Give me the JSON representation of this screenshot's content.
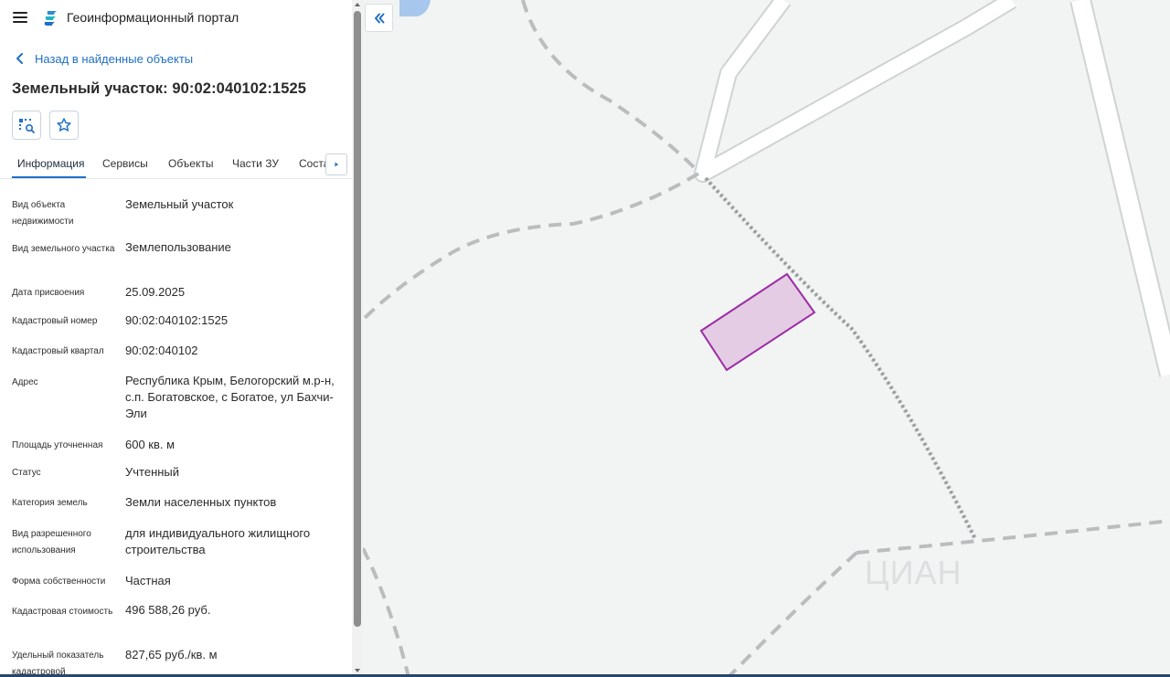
{
  "header": {
    "menu_icon": "hamburger-menu-icon",
    "logo_icon": "portal-logo-icon",
    "title": "Геоинформационный портал"
  },
  "back_link": {
    "icon": "chevron-left-icon",
    "label": "Назад в найденные объекты"
  },
  "object": {
    "title": "Земельный участок: 90:02:040102:1525"
  },
  "actions": [
    {
      "icon": "zoom-to-object-icon"
    },
    {
      "icon": "star-outline-icon"
    }
  ],
  "tabs": [
    {
      "label": "Информация",
      "active": true
    },
    {
      "label": "Сервисы",
      "active": false
    },
    {
      "label": "Объекты",
      "active": false
    },
    {
      "label": "Части ЗУ",
      "active": false
    },
    {
      "label": "Соста",
      "active": false
    }
  ],
  "tab_scroll_icon": "caret-right-icon",
  "attributes": [
    {
      "label": "Вид объекта недвижимости",
      "value": "Земельный участок"
    },
    {
      "label": "Вид земельного участка",
      "value": "Землепользование"
    },
    {
      "label": "Дата присвоения",
      "value": "25.09.2025"
    },
    {
      "label": "Кадастровый номер",
      "value": "90:02:040102:1525"
    },
    {
      "label": "Кадастровый квартал",
      "value": "90:02:040102"
    },
    {
      "label": "Адрес",
      "value": "Республика Крым, Белогорский м.р-н, с.п. Богатовское, с Богатое, ул Бахчи-Эли"
    },
    {
      "label": "Площадь уточненная",
      "value": "600 кв. м"
    },
    {
      "label": "Статус",
      "value": "Учтенный"
    },
    {
      "label": "Категория земель",
      "value": "Земли населенных пунктов"
    },
    {
      "label": "Вид разрешенного использования",
      "value": "для индивидуального жилищного строительства"
    },
    {
      "label": "Форма собственности",
      "value": "Частная"
    },
    {
      "label": "Кадастровая стоимость",
      "value": "496 588,26 руб."
    },
    {
      "label": "Удельный показатель кадастровой",
      "value": "827,65 руб./кв. м"
    }
  ],
  "map": {
    "collapse_icon": "double-chevron-left-icon",
    "watermark": "ЦИАН",
    "parcel_fill": "#e3c8e3",
    "parcel_stroke": "#9b2ea4",
    "road_color": "#ffffff",
    "road_outline": "#cfd3d3",
    "path_color": "#b9bdbd"
  },
  "colors": {
    "accent": "#1f6fc5",
    "text": "#2a2a2a"
  }
}
